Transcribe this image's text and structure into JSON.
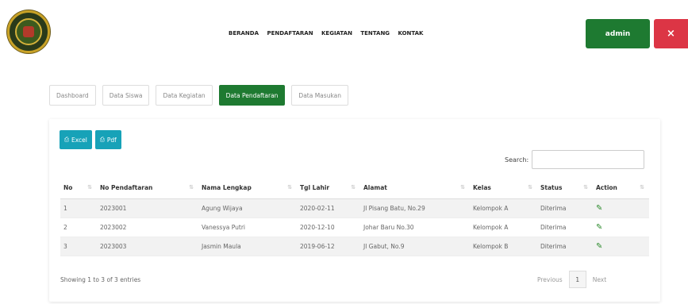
{
  "header": {
    "nav": [
      "BERANDA",
      "PENDAFTARAN",
      "KEGIATAN",
      "TENTANG",
      "KONTAK"
    ],
    "admin_label": "admin",
    "close_label": "×"
  },
  "tabs": [
    {
      "label": "Dashboard",
      "active": false
    },
    {
      "label": "Data Siswa",
      "active": false
    },
    {
      "label": "Data Kegiatan",
      "active": false
    },
    {
      "label": "Data Pendaftaran",
      "active": true
    },
    {
      "label": "Data Masukan",
      "active": false
    }
  ],
  "toolbar": {
    "excel_label": "Excel",
    "pdf_label": "Pdf",
    "search_label": "Search:"
  },
  "table": {
    "headers": [
      "No",
      "No Pendaftaran",
      "Nama Lengkap",
      "Tgl Lahir",
      "Alamat",
      "Kelas",
      "Status",
      "Action"
    ],
    "rows": [
      [
        "1",
        "2023001",
        "Agung Wijaya",
        "2020-02-11",
        "Jl Pisang Batu, No.29",
        "Kelompok A",
        "Diterima"
      ],
      [
        "2",
        "2023002",
        "Vanessya Putri",
        "2020-12-10",
        "Johar Baru No.30",
        "Kelompok A",
        "Diterima"
      ],
      [
        "3",
        "2023003",
        "Jasmin Maula",
        "2019-06-12",
        "Jl Gabut, No.9",
        "Kelompok B",
        "Diterima"
      ]
    ]
  },
  "footer": {
    "info": "Showing 1 to 3 of 3 entries",
    "previous": "Previous",
    "page": "1",
    "next": "Next"
  },
  "colors": {
    "primary": "#1e7a31",
    "danger": "#dc3545",
    "info": "#17a2b8"
  }
}
